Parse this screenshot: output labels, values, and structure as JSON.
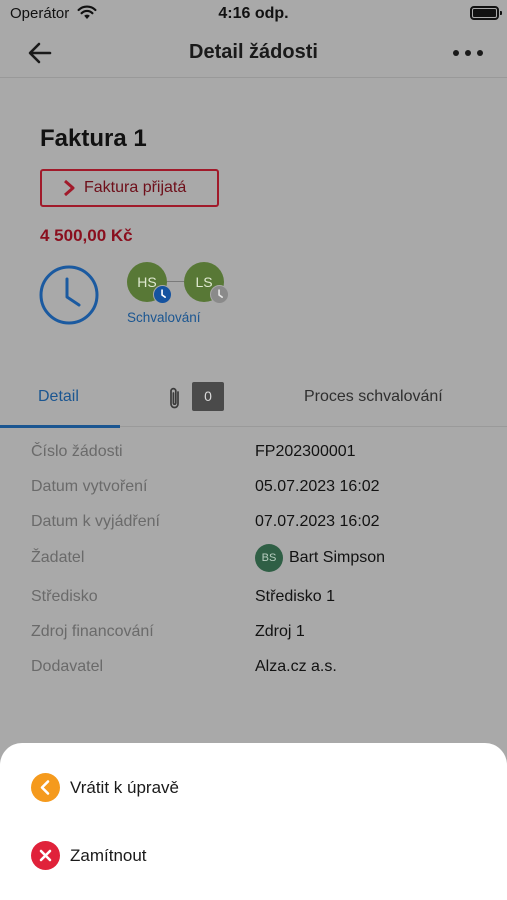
{
  "status_bar": {
    "carrier": "Operátor",
    "time": "4:16 odp."
  },
  "nav": {
    "title": "Detail žádosti"
  },
  "request": {
    "name": "Faktura 1",
    "status_label": "Faktura přijatá",
    "amount": "4 500,00 Kč",
    "approvers": [
      {
        "initials": "HS"
      },
      {
        "initials": "LS"
      }
    ],
    "approval_label": "Schvalování"
  },
  "tabs": {
    "detail": "Detail",
    "attachments_count": "0",
    "process": "Proces schvalování"
  },
  "details": [
    {
      "key": "Číslo žádosti",
      "value": "FP202300001"
    },
    {
      "key": "Datum vytvoření",
      "value": "05.07.2023 16:02"
    },
    {
      "key": "Datum k vyjádření",
      "value": "07.07.2023 16:02"
    },
    {
      "key": "Žadatel",
      "value": "Bart Simpson",
      "avatar": "BS"
    },
    {
      "key": "Středisko",
      "value": "Středisko 1"
    },
    {
      "key": "Zdroj financování",
      "value": "Zdroj 1"
    },
    {
      "key": "Dodavatel",
      "value": "Alza.cz a.s."
    }
  ],
  "actions": {
    "return_label": "Vrátit k úpravě",
    "reject_label": "Zamítnout"
  },
  "colors": {
    "accent": "#1b5691",
    "status_red": "#a11a2a",
    "approver_green": "#587836",
    "return_orange": "#f59a1d",
    "reject_red": "#e0223a"
  }
}
